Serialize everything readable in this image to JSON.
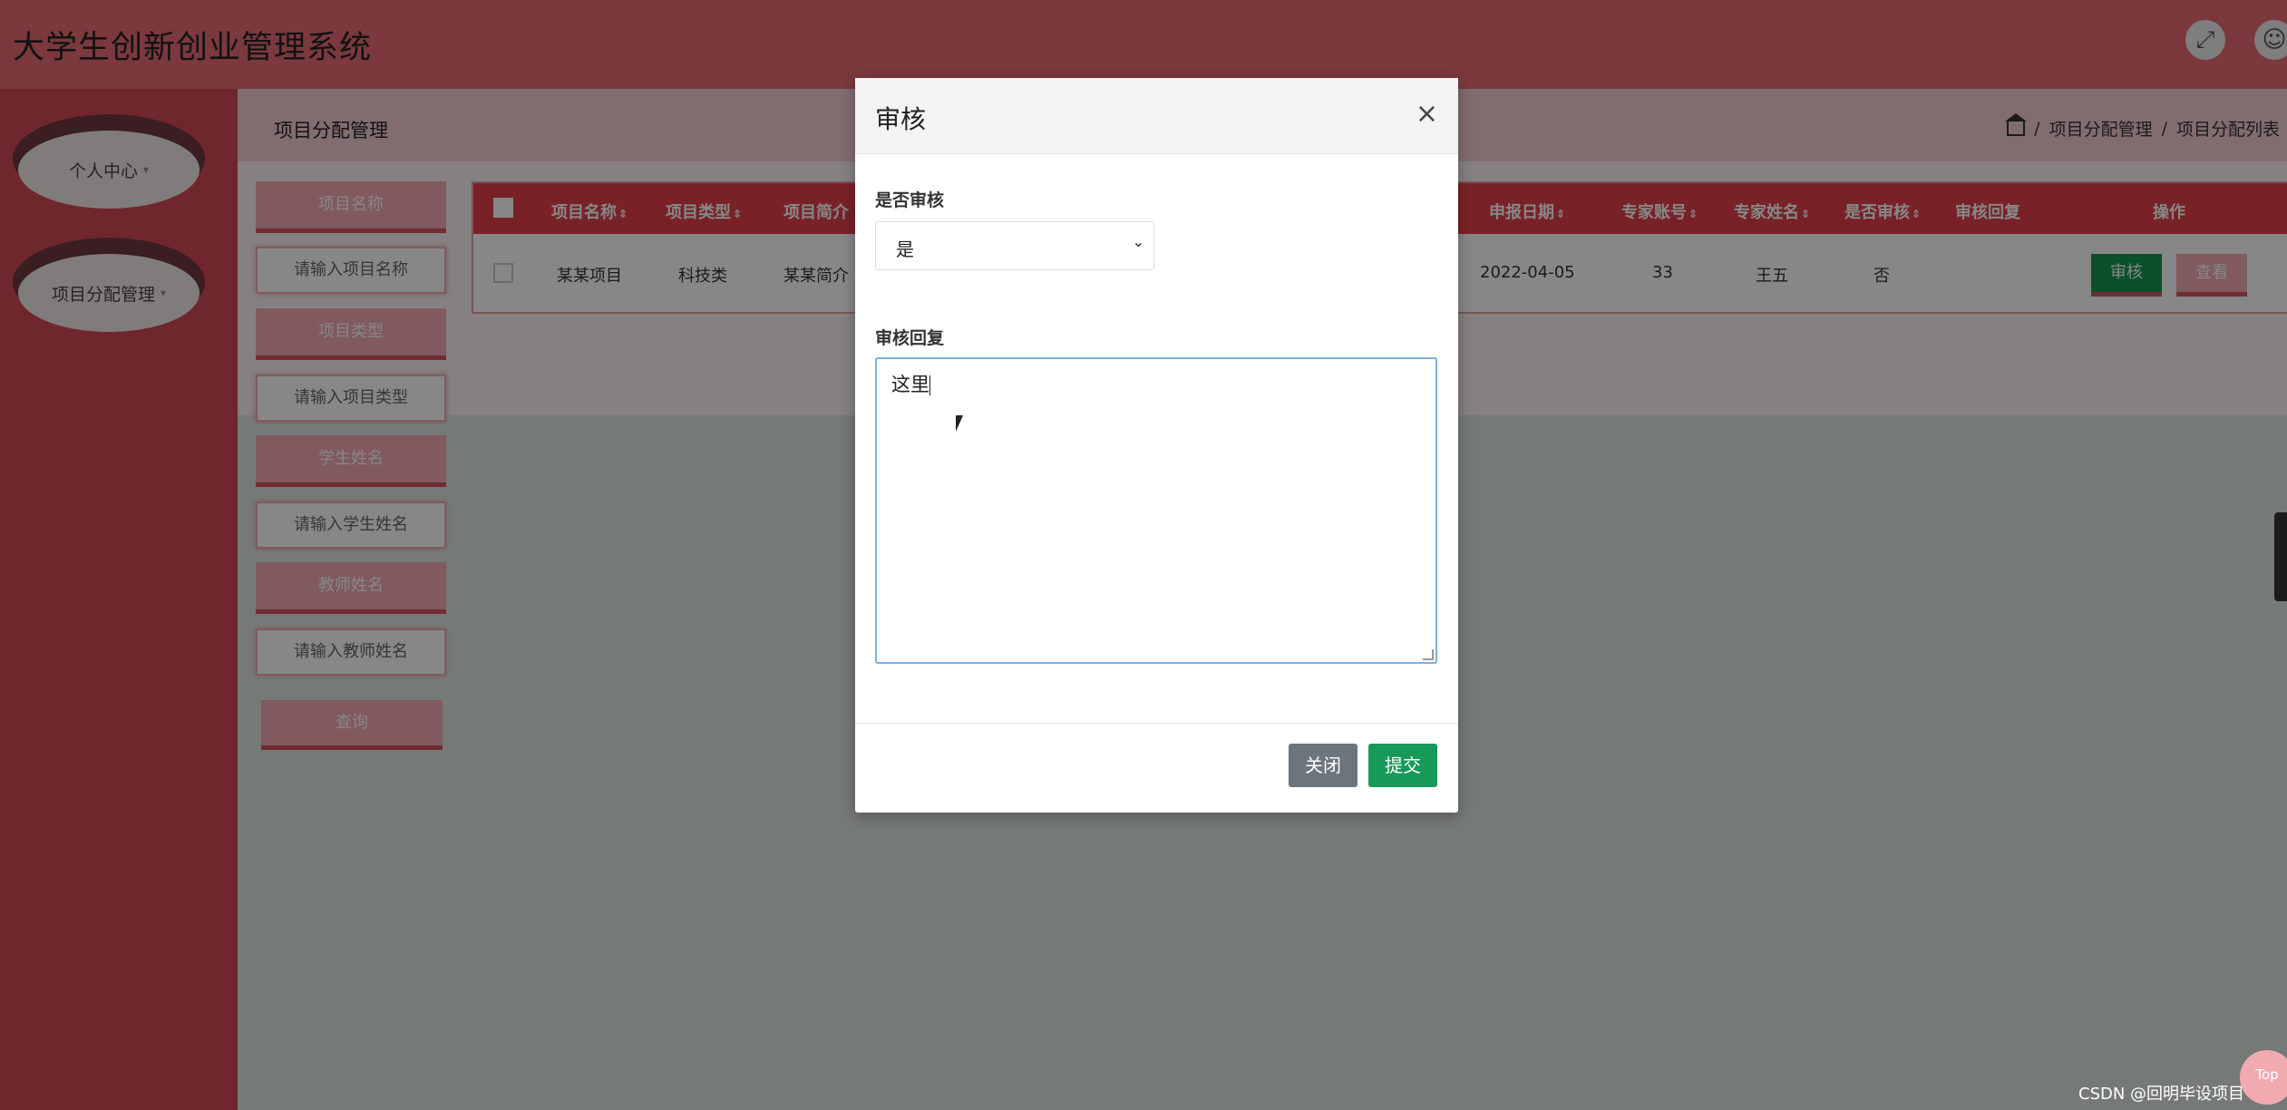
{
  "app": {
    "title": "大学生创新创业管理系统"
  },
  "header_icons": [
    "fullscreen-icon",
    "user-icon"
  ],
  "sidebar": {
    "items": [
      {
        "label": "个人中心"
      },
      {
        "label": "项目分配管理"
      }
    ]
  },
  "page": {
    "title": "项目分配管理",
    "breadcrumb": [
      "项目分配管理",
      "项目分配列表"
    ]
  },
  "search": {
    "project_name_label": "项目名称",
    "project_name_placeholder": "请输入项目名称",
    "project_type_label": "项目类型",
    "project_type_placeholder": "请输入项目类型",
    "student_name_label": "学生姓名",
    "student_name_placeholder": "请输入学生姓名",
    "teacher_name_label": "教师姓名",
    "teacher_name_placeholder": "请输入教师姓名",
    "button_label": "查询"
  },
  "table": {
    "columns": [
      "项目名称",
      "项目类型",
      "项目简介",
      "申报日期",
      "专家账号",
      "专家姓名",
      "是否审核",
      "审核回复",
      "操作"
    ],
    "rows": [
      {
        "project_name": "某某项目",
        "project_type": "科技类",
        "intro": "某某简介",
        "date": "2022-04-05",
        "expert_account": "33",
        "expert_name": "王五",
        "audited": "否",
        "reply": ""
      }
    ],
    "actions": {
      "audit": "审核",
      "view": "查看"
    }
  },
  "modal": {
    "title": "审核",
    "close_symbol": "×",
    "audit_label": "是否审核",
    "audit_value": "是",
    "reply_label": "审核回复",
    "reply_value": "这里",
    "close_button": "关闭",
    "submit_button": "提交"
  },
  "top_button": "Top",
  "watermark": "CSDN @回明毕设项目",
  "colors": {
    "header": "#e96b74",
    "sidebar": "#d14a55",
    "table_header": "#e2404d",
    "accent_green": "#17995a",
    "secondary_gray": "#6c757d"
  }
}
